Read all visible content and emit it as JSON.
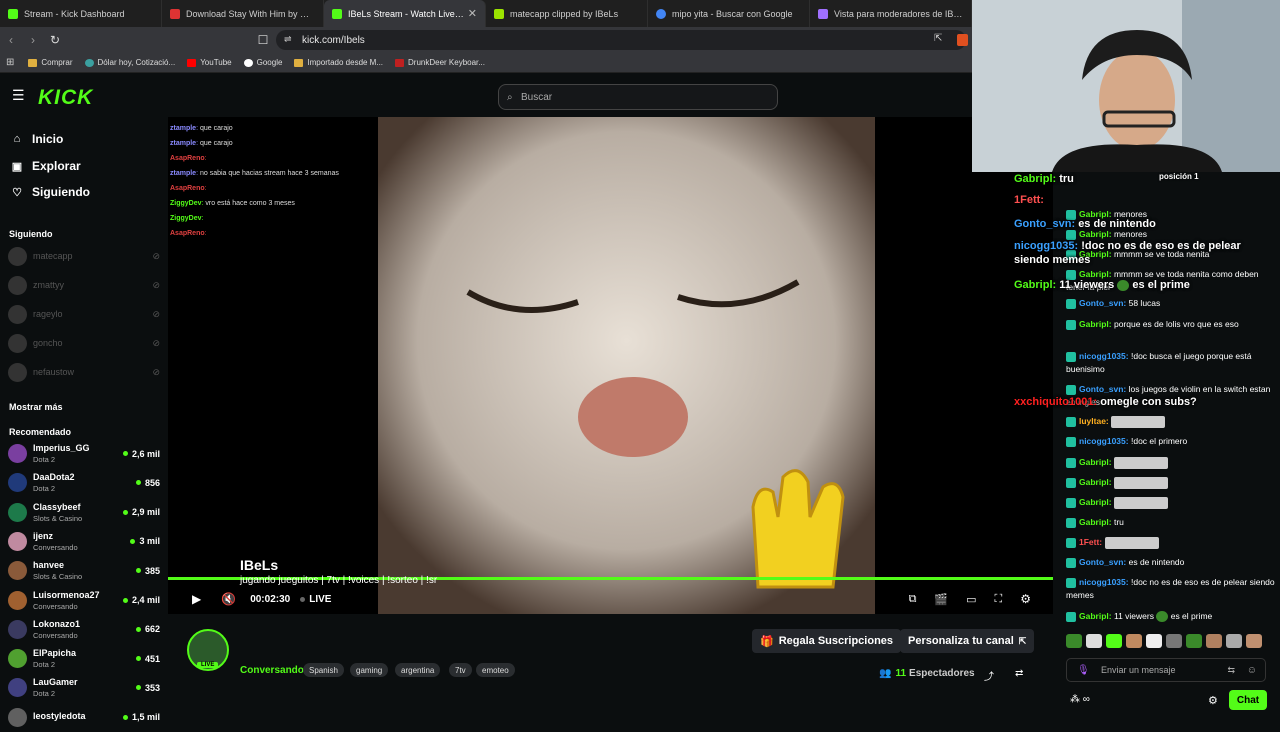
{
  "browser": {
    "tabs": [
      {
        "label": "Stream - Kick Dashboard",
        "color": "#53fc18"
      },
      {
        "label": "Download Stay With Him by Santiag",
        "color": "#d33"
      },
      {
        "label": "IBeLs Stream - Watch Live on Kick",
        "color": "#53fc18"
      },
      {
        "label": "matecapp clipped by IBeLs",
        "color": "#9be300"
      },
      {
        "label": "mipo yita - Buscar con Google",
        "color": "#4285f4"
      },
      {
        "label": "Vista para moderadores de IBeLs_",
        "color": "#a070ff"
      }
    ],
    "url": "kick.com/Ibels",
    "bookmarks": [
      {
        "label": "Comprar",
        "icon": "folder-icon"
      },
      {
        "label": "Dólar hoy, Cotizació...",
        "icon": "globe-icon"
      },
      {
        "label": "YouTube",
        "icon": "youtube-icon"
      },
      {
        "label": "Google",
        "icon": "google-icon"
      },
      {
        "label": "Importado desde M...",
        "icon": "folder-icon"
      },
      {
        "label": "DrunkDeer Keyboar...",
        "icon": "drunkdeer-icon"
      }
    ]
  },
  "kick": {
    "logo": "KICK",
    "search_placeholder": "Buscar",
    "nav": [
      "Inicio",
      "Explorar",
      "Siguiendo"
    ],
    "following_title": "Siguiendo",
    "following": [
      "matecapp",
      "zmattyy",
      "rageylo",
      "goncho",
      "nefaustow"
    ],
    "show_more": "Mostrar más",
    "recommended_title": "Recomendado",
    "recommended": [
      {
        "name": "Imperius_GG",
        "cat": "Dota 2",
        "viewers": "2,6 mil",
        "color": "#7a3fa0"
      },
      {
        "name": "DaaDota2",
        "cat": "Dota 2",
        "viewers": "856",
        "color": "#203a7a"
      },
      {
        "name": "Classybeef",
        "cat": "Slots & Casino",
        "viewers": "2,9 mil",
        "color": "#1d7a4a"
      },
      {
        "name": "ijenz",
        "cat": "Conversando",
        "viewers": "3 mil",
        "color": "#c08aa0"
      },
      {
        "name": "hanvee",
        "cat": "Slots & Casino",
        "viewers": "385",
        "color": "#8a5a3a"
      },
      {
        "name": "Luisormenoa27",
        "cat": "Conversando",
        "viewers": "2,4 mil",
        "color": "#a06030"
      },
      {
        "name": "Lokonazo1",
        "cat": "Conversando",
        "viewers": "662",
        "color": "#3a3a60"
      },
      {
        "name": "ElPapicha",
        "cat": "Dota 2",
        "viewers": "451",
        "color": "#50a030"
      },
      {
        "name": "LauGamer",
        "cat": "Dota 2",
        "viewers": "353",
        "color": "#404080"
      },
      {
        "name": "leostyledota",
        "cat": "",
        "viewers": "1,5 mil",
        "color": "#606060"
      }
    ],
    "video_chat": [
      {
        "user": "ztample",
        "text": "que carajo",
        "color": "#8a8aff"
      },
      {
        "user": "ztample",
        "text": "que carajo",
        "color": "#8a8aff"
      },
      {
        "user": "AsapReno",
        "text": "",
        "color": "#e04040"
      },
      {
        "user": "ztample",
        "text": "no sabia que hacias stream hace 3 semanas",
        "color": "#8a8aff"
      },
      {
        "user": "AsapReno",
        "text": "",
        "color": "#e04040"
      },
      {
        "user": "ZiggyDev",
        "text": "vro está hace como 3 meses",
        "color": "#53fc18"
      },
      {
        "user": "ZiggyDev",
        "text": "",
        "color": "#53fc18"
      },
      {
        "user": "AsapReno",
        "text": "",
        "color": "#e04040"
      }
    ],
    "player": {
      "time": "00:02:30",
      "live": "LIVE"
    },
    "channel": {
      "name": "IBeLs",
      "title": "jugando jueguitos | 7tv | !voices | !sorteo | !sr",
      "category": "Conversando",
      "tags": [
        "Spanish",
        "gaming",
        "argentina",
        "7tv",
        "emoteo"
      ],
      "live_badge": "LIVE",
      "gift_label": "Regala Suscripciones",
      "customize_label": "Personaliza tu canal",
      "viewers": "11",
      "viewers_label": "Espectadores"
    }
  },
  "overlay": {
    "position": "posición 1",
    "lines": [
      {
        "user": "Gabripl:",
        "text": "tru",
        "color": "#53fc18"
      },
      {
        "user": "1Fett:",
        "text": "",
        "color": "#ff5050"
      },
      {
        "user": "Gonto_svn:",
        "text": "es de nintendo",
        "color": "#3aa0ff"
      },
      {
        "user": "nicogg1035:",
        "text": "!doc no es de eso es de pelear siendo memes",
        "color": "#3aa0ff"
      },
      {
        "user": "Gabripl:",
        "text": "11 viewers",
        "text2": "es el prime",
        "color": "#53fc18"
      },
      {
        "user": "xxchiquito1001:",
        "text": "omegle con subs?",
        "color": "#ff2020"
      }
    ]
  },
  "chat": {
    "messages": [
      {
        "user": "Gabripl:",
        "text": "menores",
        "color": "#53fc18"
      },
      {
        "user": "Gabripl:",
        "text": "menores",
        "color": "#53fc18"
      },
      {
        "user": "Gabripl:",
        "text": "mmmm se ve toda nenita",
        "color": "#53fc18"
      },
      {
        "user": "Gabripl:",
        "text": "mmmm se ve toda nenita como deben tener la piel",
        "color": "#53fc18"
      },
      {
        "user": "Gonto_svn:",
        "text": "58 lucas",
        "color": "#3aa0ff"
      },
      {
        "user": "Gabripl:",
        "text": "porque es de lolis vro que es eso",
        "color": "#53fc18"
      },
      {
        "user": "nicogg1035:",
        "text": "!doc busca el juego porque está buenisimo",
        "color": "#3aa0ff"
      },
      {
        "user": "Gonto_svn:",
        "text": "los juegos de violin en la switch estan en ingles",
        "color": "#3aa0ff"
      },
      {
        "user": "luyltae:",
        "text": "",
        "color": "#ffb020"
      },
      {
        "user": "nicogg1035:",
        "text": "!doc el primero",
        "color": "#3aa0ff"
      },
      {
        "user": "Gabripl:",
        "text": "",
        "color": "#53fc18"
      },
      {
        "user": "Gabripl:",
        "text": "",
        "color": "#53fc18"
      },
      {
        "user": "Gabripl:",
        "text": "",
        "color": "#53fc18"
      },
      {
        "user": "Gabripl:",
        "text": "tru",
        "color": "#53fc18"
      },
      {
        "user": "1Fett:",
        "text": "",
        "color": "#ff5050"
      },
      {
        "user": "Gonto_svn:",
        "text": "es de nintendo",
        "color": "#3aa0ff"
      },
      {
        "user": "nicogg1035:",
        "text": "!doc no es de eso es de pelear siendo memes",
        "color": "#3aa0ff"
      },
      {
        "user": "Gabripl:",
        "text": "11 viewers",
        "text2": "es el prime",
        "color": "#53fc18"
      }
    ],
    "input_placeholder": "Enviar un mensaje",
    "send_label": "Chat"
  }
}
